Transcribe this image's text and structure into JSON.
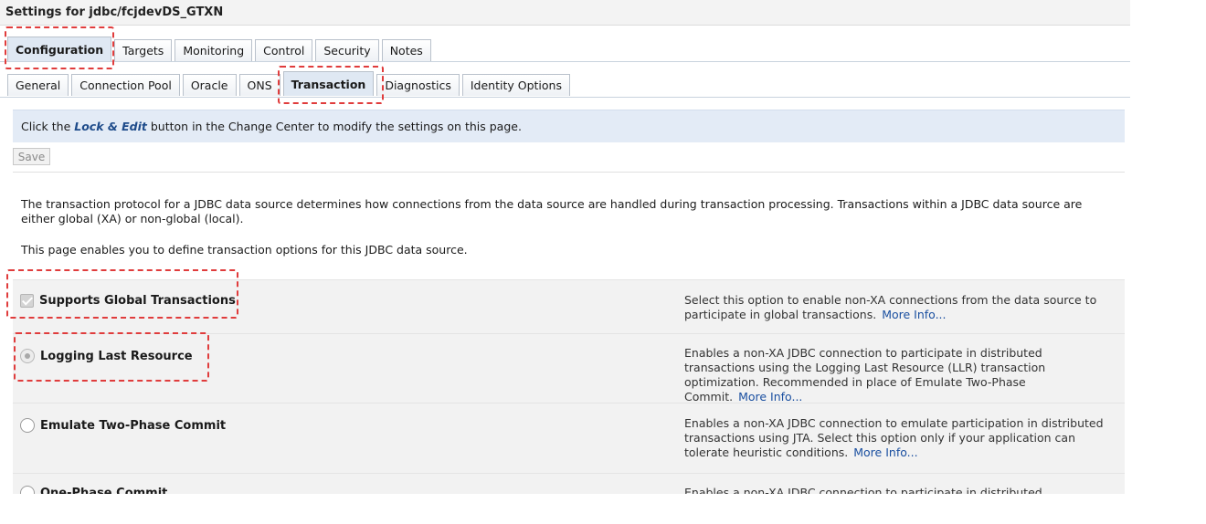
{
  "title": "Settings for jdbc/fcjdevDS_GTXN",
  "main_tabs": [
    "Configuration",
    "Targets",
    "Monitoring",
    "Control",
    "Security",
    "Notes"
  ],
  "sub_tabs": [
    "General",
    "Connection Pool",
    "Oracle",
    "ONS",
    "Transaction",
    "Diagnostics",
    "Identity Options"
  ],
  "info": {
    "before": "Click the ",
    "link": "Lock & Edit",
    "after": " button in the Change Center to modify the settings on this page."
  },
  "save_label": "Save",
  "description_1": "The transaction protocol for a JDBC data source determines how connections from the data source are handled during transaction processing. Transactions within a JDBC data source are either global (XA) or non-global (local).",
  "description_2": "This page enables you to define transaction options for this JDBC data source.",
  "options": [
    {
      "label": "Supports Global Transactions",
      "help": "Select this option to enable non-XA connections from the data source to participate in global transactions.",
      "more": "More Info..."
    },
    {
      "label": "Logging Last Resource",
      "help": "Enables a non-XA JDBC connection to participate in distributed transactions using the Logging Last Resource (LLR) transaction optimization. Recommended in place of Emulate Two-Phase Commit.",
      "more": "More Info..."
    },
    {
      "label": "Emulate Two-Phase Commit",
      "help": "Enables a non-XA JDBC connection to emulate participation in distributed transactions using JTA. Select this option only if your application can tolerate heuristic conditions.",
      "more": "More Info..."
    },
    {
      "label": "One-Phase Commit",
      "help": "Enables a non-XA JDBC connection to participate in distributed transactions",
      "more": ""
    }
  ],
  "colors": {
    "highlight": "#e03c3c",
    "link": "#1a4fa0",
    "info_bg": "#e3ebf6"
  }
}
